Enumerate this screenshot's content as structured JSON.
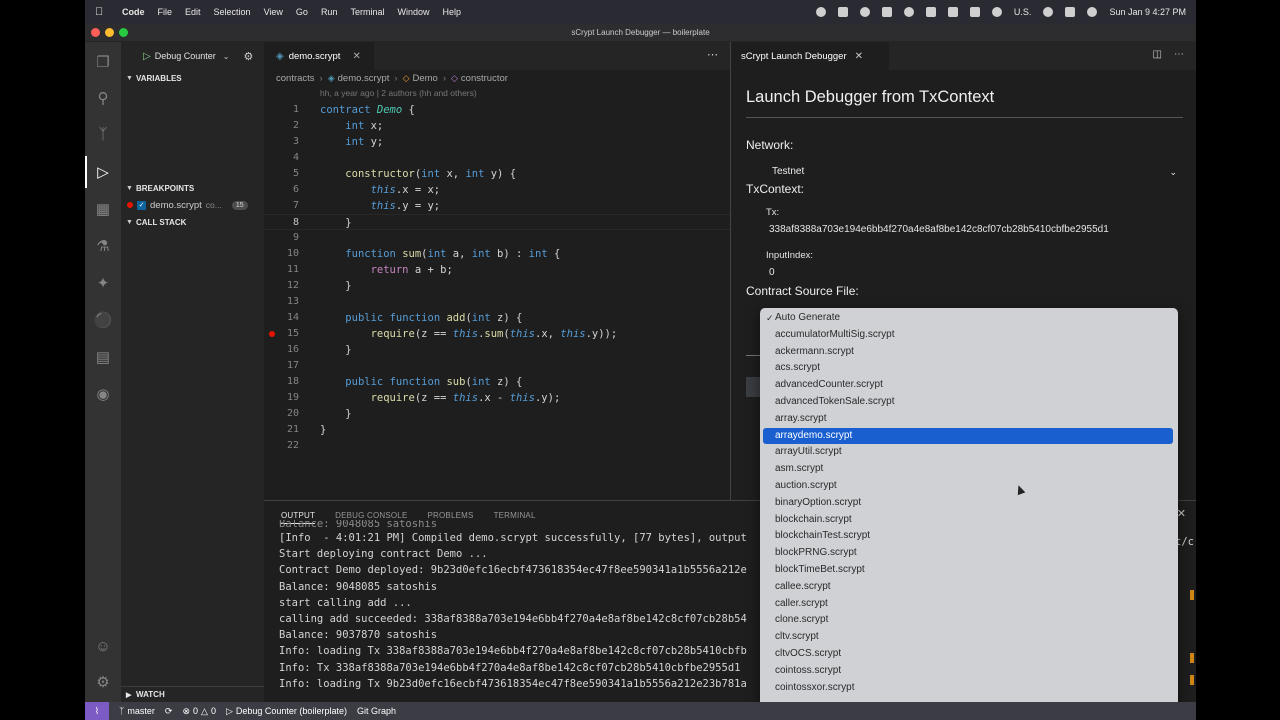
{
  "menubar": {
    "app": "Code",
    "items": [
      "File",
      "Edit",
      "Selection",
      "View",
      "Go",
      "Run",
      "Terminal",
      "Window",
      "Help"
    ],
    "locale": "U.S.",
    "clock": "Sun Jan 9  4:27 PM"
  },
  "window": {
    "title": "sCrypt Launch Debugger — boilerplate"
  },
  "debug": {
    "config": "Debug Counter"
  },
  "sidebar": {
    "variables": "VARIABLES",
    "breakpoints": "BREAKPOINTS",
    "callstack": "CALL STACK",
    "watch": "WATCH",
    "breakpoint": {
      "file": "demo.scrypt",
      "path": "co...",
      "line": "15"
    }
  },
  "editor": {
    "tab": "demo.scrypt",
    "breadcrumbs": [
      "contracts",
      "demo.scrypt",
      "Demo",
      "constructor"
    ],
    "blame": "hh, a year ago | 2 authors (hh and others)",
    "line_numbers": [
      "1",
      "2",
      "3",
      "4",
      "5",
      "6",
      "7",
      "8",
      "9",
      "10",
      "11",
      "12",
      "13",
      "14",
      "15",
      "16",
      "17",
      "18",
      "19",
      "20",
      "21",
      "22"
    ],
    "current_line": 8,
    "breakpoint_line": 15
  },
  "panel": {
    "tabs": [
      "OUTPUT",
      "DEBUG CONSOLE",
      "PROBLEMS",
      "TERMINAL"
    ],
    "active_tab": "OUTPUT",
    "lines": [
      "Balance: 9048085 satoshis",
      "[Info  - 4:01:21 PM] Compiled demo.scrypt successfully, [77 bytes], output",
      "Start deploying contract Demo ...",
      "Contract Demo deployed: 9b23d0efc16ecbf473618354ec47f8ee590341a1b5556a212e",
      "Balance: 9048085 satoshis",
      "start calling add ...",
      "calling add succeeded: 338af8388a703e194e6bb4f270a4e8af8be142c8cf07cb28b54",
      "Balance: 9037870 satoshis",
      "Info: loading Tx 338af8388a703e194e6bb4f270a4e8af8be142c8cf07cb28b5410cbfb",
      "Info: Tx 338af8388a703e194e6bb4f270a4e8af8be142c8cf07cb28b5410cbfbe2955d1",
      "Info: loading Tx 9b23d0efc16ecbf473618354ec47f8ee590341a1b5556a212e23b781a"
    ],
    "overflow_text": "t/c"
  },
  "webview": {
    "tab": "sCrypt Launch Debugger",
    "title": "Launch Debugger from TxContext",
    "network_label": "Network:",
    "network_value": "Testnet",
    "txcontext_label": "TxContext:",
    "tx_label": "Tx:",
    "tx_value": "338af8388a703e194e6bb4f270a4e8af8be142c8cf07cb28b5410cbfbe2955d1",
    "input_index_label": "InputIndex:",
    "input_index_value": "0",
    "source_label": "Contract Source File:"
  },
  "dropdown": {
    "selected": "arraydemo.scrypt",
    "checked": "Auto Generate",
    "options": [
      "Auto Generate",
      "accumulatorMultiSig.scrypt",
      "ackermann.scrypt",
      "acs.scrypt",
      "advancedCounter.scrypt",
      "advancedTokenSale.scrypt",
      "array.scrypt",
      "arraydemo.scrypt",
      "arrayUtil.scrypt",
      "asm.scrypt",
      "auction.scrypt",
      "binaryOption.scrypt",
      "blockchain.scrypt",
      "blockchainTest.scrypt",
      "blockPRNG.scrypt",
      "blockTimeBet.scrypt",
      "callee.scrypt",
      "caller.scrypt",
      "clone.scrypt",
      "cltv.scrypt",
      "cltvOCS.scrypt",
      "cointoss.scrypt",
      "cointossxor.scrypt"
    ]
  },
  "statusbar": {
    "branch": "master",
    "errors": "0",
    "warnings": "0",
    "debug": "Debug Counter (boilerplate)",
    "git": "Git Graph"
  }
}
